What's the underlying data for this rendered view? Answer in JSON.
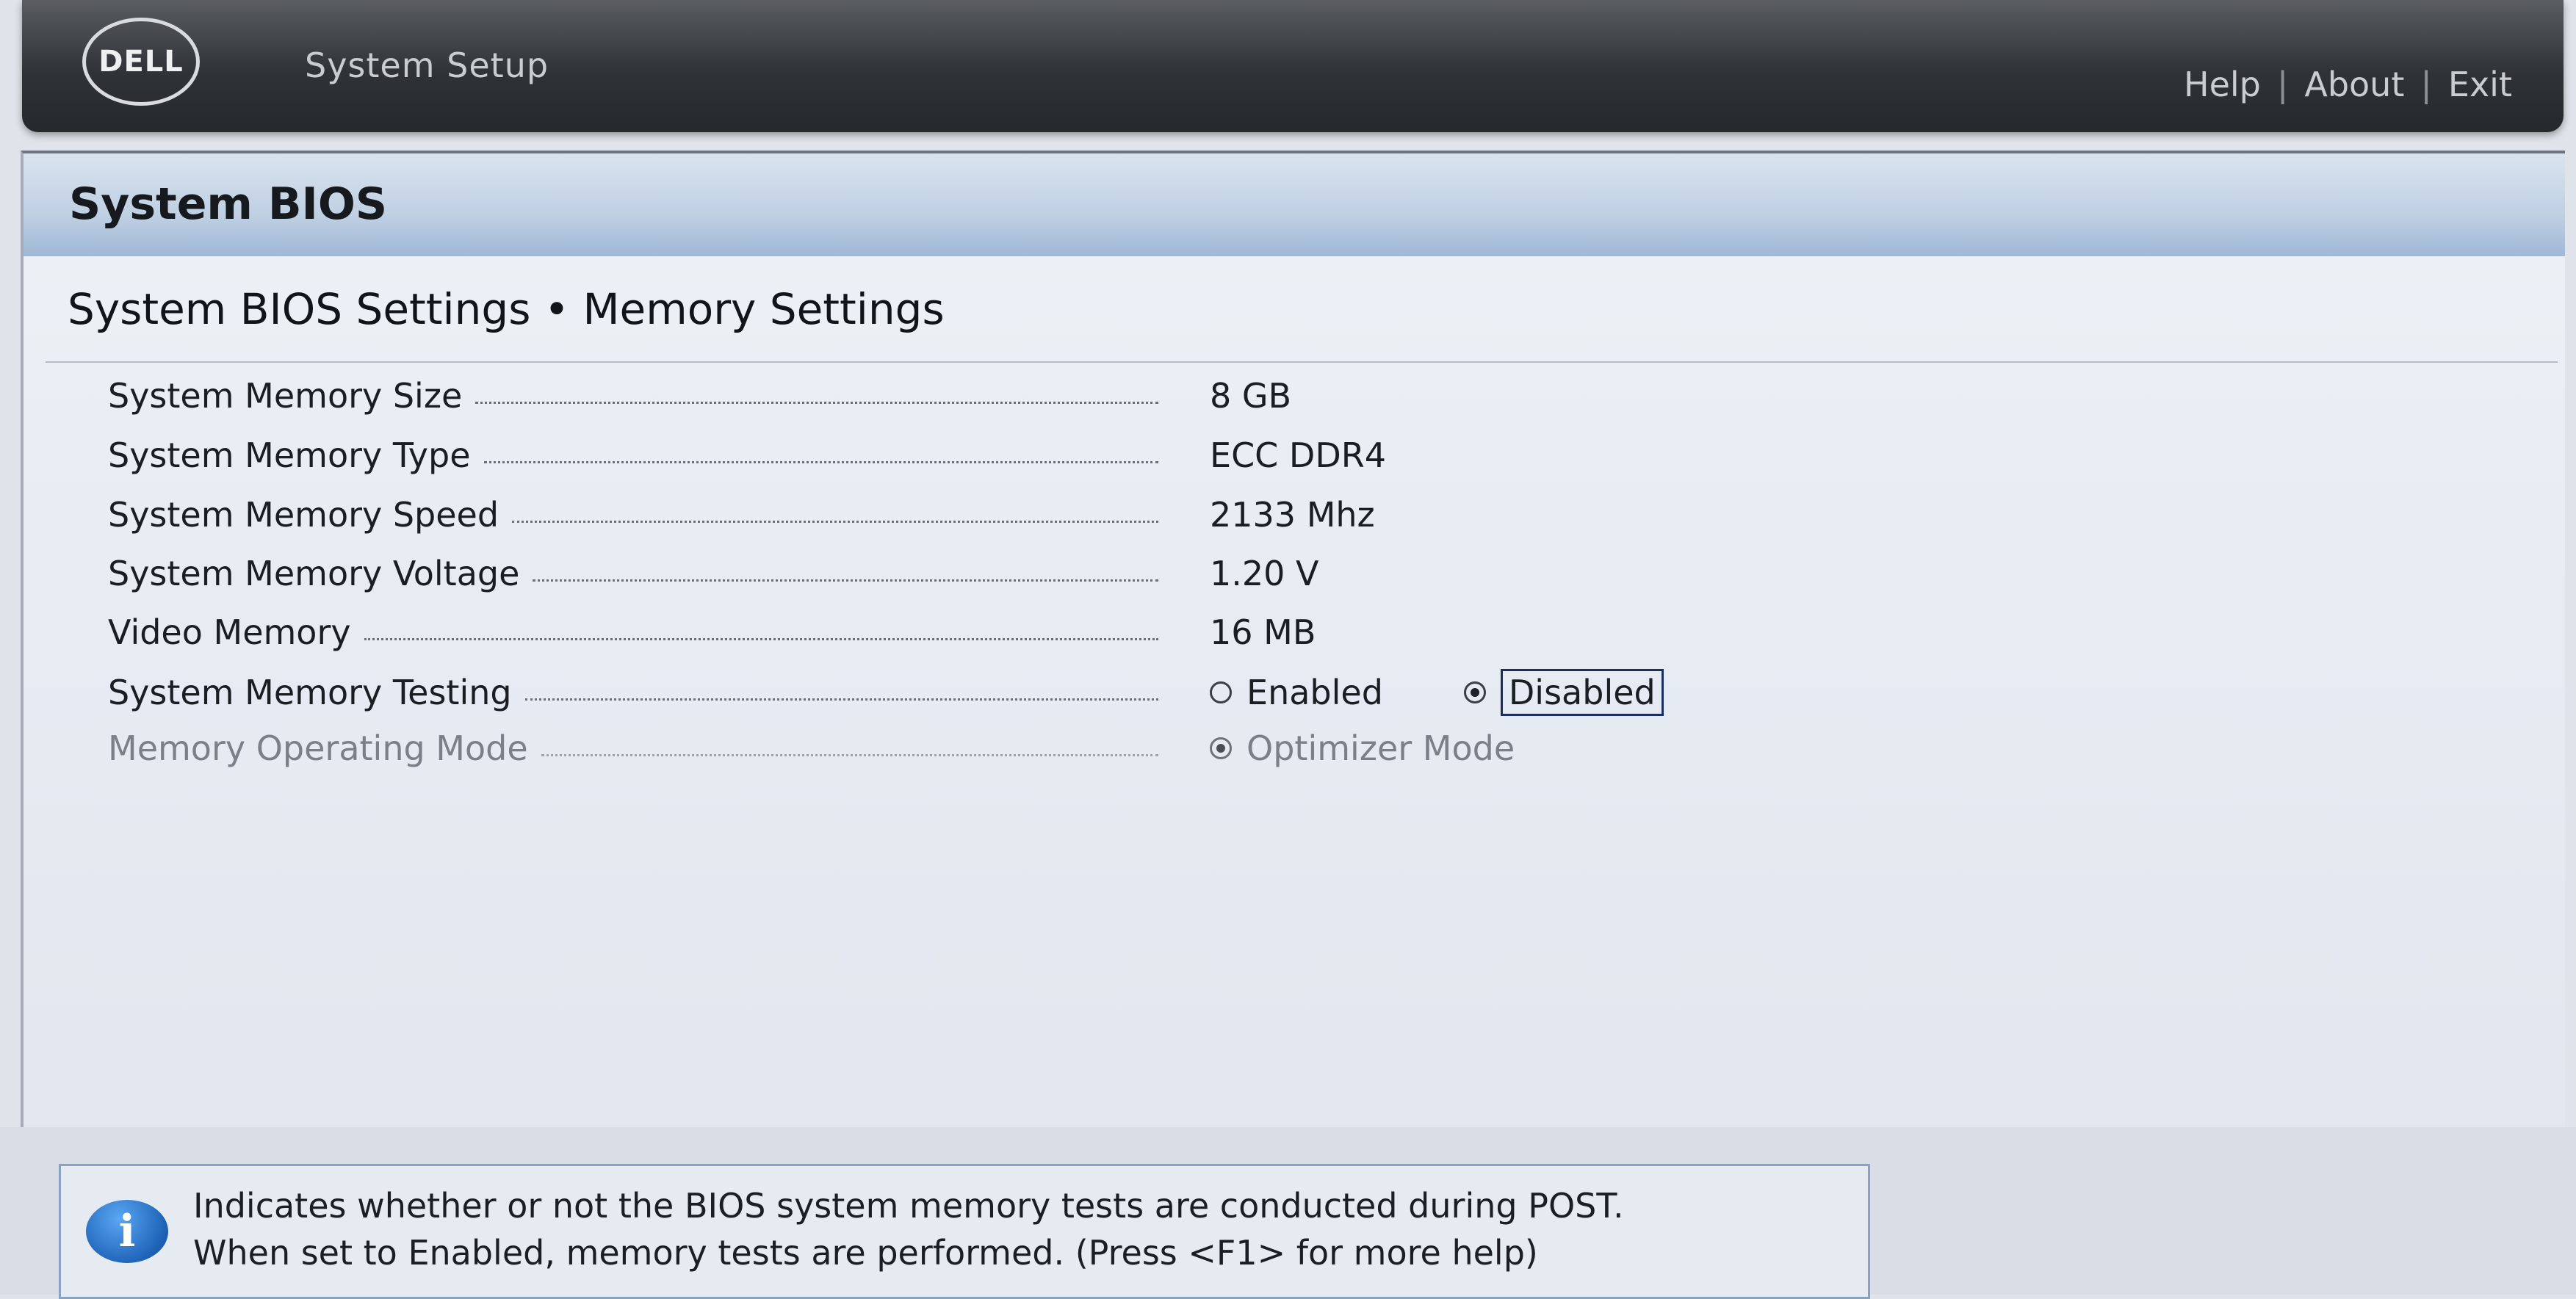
{
  "header": {
    "logo_text": "DELL",
    "app_title": "System Setup",
    "links": [
      "Help",
      "About",
      "Exit"
    ],
    "separator": "|"
  },
  "panel": {
    "title": "System BIOS",
    "breadcrumb": "System BIOS Settings • Memory Settings"
  },
  "settings": [
    {
      "label": "System Memory Size",
      "value": "8 GB"
    },
    {
      "label": "System Memory Type",
      "value": "ECC DDR4"
    },
    {
      "label": "System Memory Speed",
      "value": "2133 Mhz"
    },
    {
      "label": "System Memory Voltage",
      "value": "1.20 V"
    },
    {
      "label": "Video Memory",
      "value": "16 MB"
    },
    {
      "label": "System Memory Testing",
      "options": [
        "Enabled",
        "Disabled"
      ],
      "selected": "Disabled"
    },
    {
      "label": "Memory Operating Mode",
      "options": [
        "Optimizer Mode"
      ],
      "selected": "Optimizer Mode",
      "disabled": true
    }
  ],
  "help": {
    "icon": "info-icon",
    "line1": "Indicates whether or not the BIOS system memory tests are conducted during POST.",
    "line2": "When set to Enabled, memory tests are performed. (Press <F1> for more help)"
  }
}
